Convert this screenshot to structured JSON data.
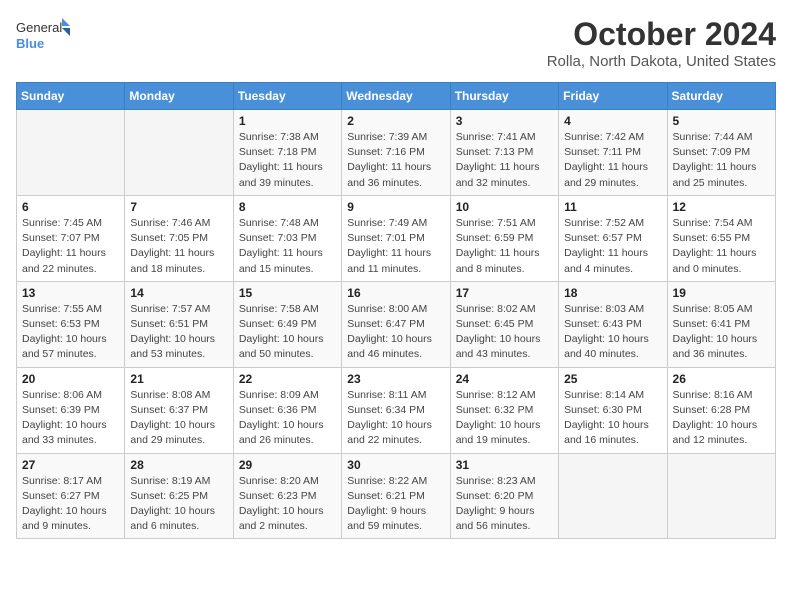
{
  "header": {
    "logo_general": "General",
    "logo_blue": "Blue",
    "title": "October 2024",
    "subtitle": "Rolla, North Dakota, United States"
  },
  "weekdays": [
    "Sunday",
    "Monday",
    "Tuesday",
    "Wednesday",
    "Thursday",
    "Friday",
    "Saturday"
  ],
  "weeks": [
    [
      {
        "day": "",
        "info": ""
      },
      {
        "day": "",
        "info": ""
      },
      {
        "day": "1",
        "info": "Sunrise: 7:38 AM\nSunset: 7:18 PM\nDaylight: 11 hours and 39 minutes."
      },
      {
        "day": "2",
        "info": "Sunrise: 7:39 AM\nSunset: 7:16 PM\nDaylight: 11 hours and 36 minutes."
      },
      {
        "day": "3",
        "info": "Sunrise: 7:41 AM\nSunset: 7:13 PM\nDaylight: 11 hours and 32 minutes."
      },
      {
        "day": "4",
        "info": "Sunrise: 7:42 AM\nSunset: 7:11 PM\nDaylight: 11 hours and 29 minutes."
      },
      {
        "day": "5",
        "info": "Sunrise: 7:44 AM\nSunset: 7:09 PM\nDaylight: 11 hours and 25 minutes."
      }
    ],
    [
      {
        "day": "6",
        "info": "Sunrise: 7:45 AM\nSunset: 7:07 PM\nDaylight: 11 hours and 22 minutes."
      },
      {
        "day": "7",
        "info": "Sunrise: 7:46 AM\nSunset: 7:05 PM\nDaylight: 11 hours and 18 minutes."
      },
      {
        "day": "8",
        "info": "Sunrise: 7:48 AM\nSunset: 7:03 PM\nDaylight: 11 hours and 15 minutes."
      },
      {
        "day": "9",
        "info": "Sunrise: 7:49 AM\nSunset: 7:01 PM\nDaylight: 11 hours and 11 minutes."
      },
      {
        "day": "10",
        "info": "Sunrise: 7:51 AM\nSunset: 6:59 PM\nDaylight: 11 hours and 8 minutes."
      },
      {
        "day": "11",
        "info": "Sunrise: 7:52 AM\nSunset: 6:57 PM\nDaylight: 11 hours and 4 minutes."
      },
      {
        "day": "12",
        "info": "Sunrise: 7:54 AM\nSunset: 6:55 PM\nDaylight: 11 hours and 0 minutes."
      }
    ],
    [
      {
        "day": "13",
        "info": "Sunrise: 7:55 AM\nSunset: 6:53 PM\nDaylight: 10 hours and 57 minutes."
      },
      {
        "day": "14",
        "info": "Sunrise: 7:57 AM\nSunset: 6:51 PM\nDaylight: 10 hours and 53 minutes."
      },
      {
        "day": "15",
        "info": "Sunrise: 7:58 AM\nSunset: 6:49 PM\nDaylight: 10 hours and 50 minutes."
      },
      {
        "day": "16",
        "info": "Sunrise: 8:00 AM\nSunset: 6:47 PM\nDaylight: 10 hours and 46 minutes."
      },
      {
        "day": "17",
        "info": "Sunrise: 8:02 AM\nSunset: 6:45 PM\nDaylight: 10 hours and 43 minutes."
      },
      {
        "day": "18",
        "info": "Sunrise: 8:03 AM\nSunset: 6:43 PM\nDaylight: 10 hours and 40 minutes."
      },
      {
        "day": "19",
        "info": "Sunrise: 8:05 AM\nSunset: 6:41 PM\nDaylight: 10 hours and 36 minutes."
      }
    ],
    [
      {
        "day": "20",
        "info": "Sunrise: 8:06 AM\nSunset: 6:39 PM\nDaylight: 10 hours and 33 minutes."
      },
      {
        "day": "21",
        "info": "Sunrise: 8:08 AM\nSunset: 6:37 PM\nDaylight: 10 hours and 29 minutes."
      },
      {
        "day": "22",
        "info": "Sunrise: 8:09 AM\nSunset: 6:36 PM\nDaylight: 10 hours and 26 minutes."
      },
      {
        "day": "23",
        "info": "Sunrise: 8:11 AM\nSunset: 6:34 PM\nDaylight: 10 hours and 22 minutes."
      },
      {
        "day": "24",
        "info": "Sunrise: 8:12 AM\nSunset: 6:32 PM\nDaylight: 10 hours and 19 minutes."
      },
      {
        "day": "25",
        "info": "Sunrise: 8:14 AM\nSunset: 6:30 PM\nDaylight: 10 hours and 16 minutes."
      },
      {
        "day": "26",
        "info": "Sunrise: 8:16 AM\nSunset: 6:28 PM\nDaylight: 10 hours and 12 minutes."
      }
    ],
    [
      {
        "day": "27",
        "info": "Sunrise: 8:17 AM\nSunset: 6:27 PM\nDaylight: 10 hours and 9 minutes."
      },
      {
        "day": "28",
        "info": "Sunrise: 8:19 AM\nSunset: 6:25 PM\nDaylight: 10 hours and 6 minutes."
      },
      {
        "day": "29",
        "info": "Sunrise: 8:20 AM\nSunset: 6:23 PM\nDaylight: 10 hours and 2 minutes."
      },
      {
        "day": "30",
        "info": "Sunrise: 8:22 AM\nSunset: 6:21 PM\nDaylight: 9 hours and 59 minutes."
      },
      {
        "day": "31",
        "info": "Sunrise: 8:23 AM\nSunset: 6:20 PM\nDaylight: 9 hours and 56 minutes."
      },
      {
        "day": "",
        "info": ""
      },
      {
        "day": "",
        "info": ""
      }
    ]
  ]
}
